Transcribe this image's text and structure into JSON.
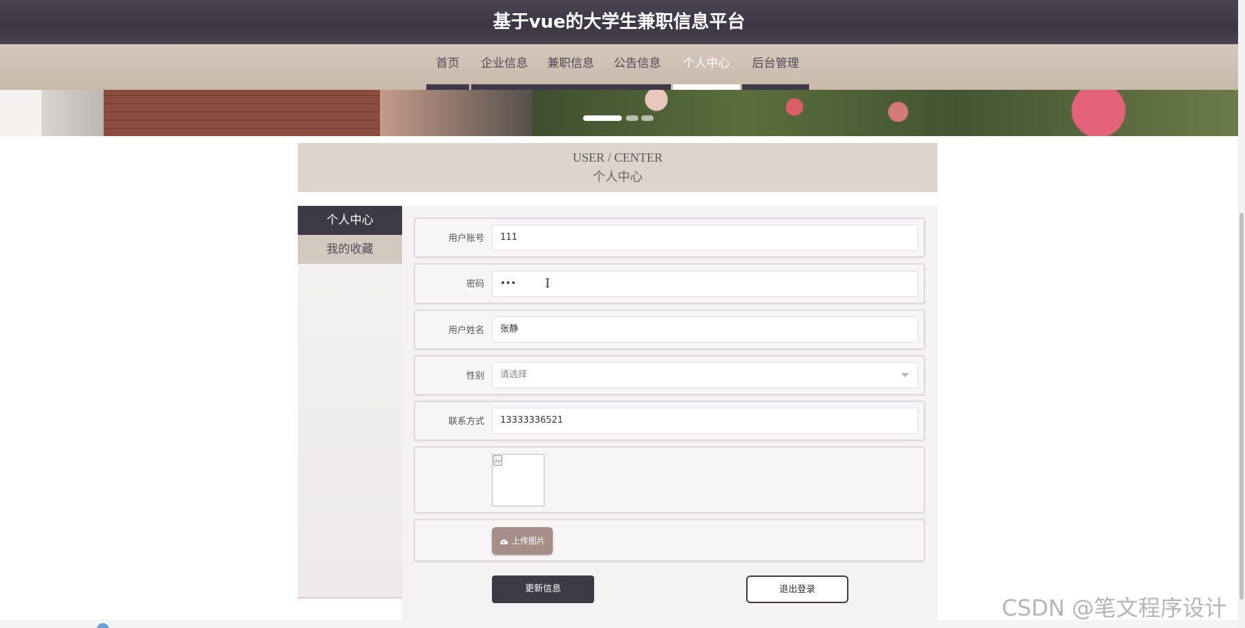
{
  "app": {
    "title": "基于vue的大学生兼职信息平台"
  },
  "nav": {
    "items": [
      {
        "label": "首页",
        "active": false
      },
      {
        "label": "企业信息",
        "active": false
      },
      {
        "label": "兼职信息",
        "active": false
      },
      {
        "label": "公告信息",
        "active": false
      },
      {
        "label": "个人中心",
        "active": true
      },
      {
        "label": "后台管理",
        "active": false
      }
    ]
  },
  "section": {
    "title_en": "USER / CENTER",
    "title_cn": "个人中心"
  },
  "side_menu": {
    "items": [
      {
        "label": "个人中心",
        "active": true
      },
      {
        "label": "我的收藏",
        "active": false
      }
    ]
  },
  "form": {
    "account": {
      "label": "用户账号",
      "value": "111"
    },
    "password": {
      "label": "密码",
      "value": "•••"
    },
    "name": {
      "label": "用户姓名",
      "value": "张静"
    },
    "gender": {
      "label": "性别",
      "placeholder": "请选择"
    },
    "contact": {
      "label": "联系方式",
      "value": "13333336521"
    },
    "upload_label": "上传图片",
    "update_button": "更新信息",
    "logout_button": "退出登录"
  },
  "watermark": "CSDN @笔文程序设计",
  "colors": {
    "primary": "#3e3947",
    "nav_bg": "#d5c7bb",
    "accent": "#a58f88"
  }
}
